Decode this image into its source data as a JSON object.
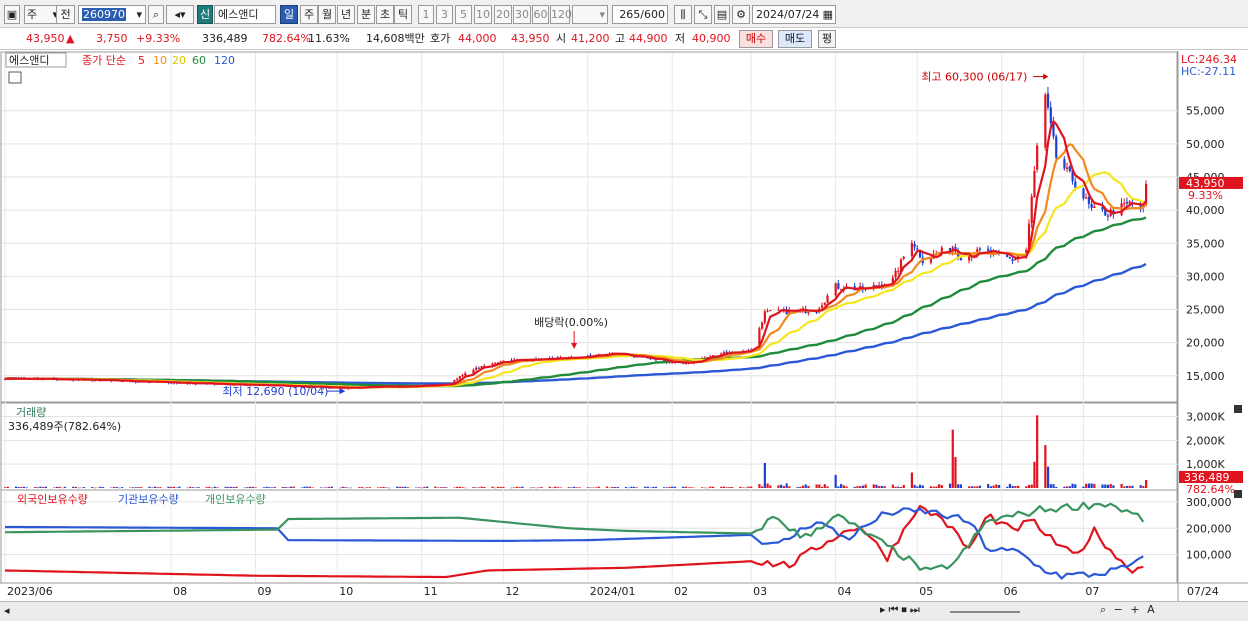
{
  "toolbar": {
    "period_week": "주",
    "prev_label": "전",
    "code": "260970",
    "new_badge": "신",
    "stock_name": "에스앤디",
    "periods": [
      "일",
      "주",
      "월",
      "년",
      "분",
      "초",
      "틱"
    ],
    "numbers": [
      "1",
      "3",
      "5",
      "10",
      "20",
      "30",
      "60",
      "120"
    ],
    "count": "265",
    "count_total": "/600",
    "date": "2024/07/24"
  },
  "quote": {
    "price": "43,950",
    "change_arrow": "▲",
    "change": "3,750",
    "change_pct": "+9.33%",
    "volume": "336,489",
    "volume_pct": "782.64%",
    "turnover_pct": "11.63%",
    "amount": "14,608백만",
    "ask_label": "호가",
    "ask1": "44,000",
    "ask2": "43,950",
    "open_label": "시",
    "open": "41,200",
    "high_label": "고",
    "high": "44,900",
    "low_label": "저",
    "low": "40,900",
    "buy_label": "매수",
    "sell_label": "매도",
    "avg_label": "평"
  },
  "colors": {
    "up": "#e0141e",
    "down": "#1b3fd1",
    "ma5": "#e0141e",
    "ma10": "#f08a1c",
    "ma20": "#f5e61c",
    "ma60": "#1e8c3a",
    "ma120": "#2b58d6",
    "foreign": "#e0141e",
    "institution": "#2b58d6",
    "individual": "#3b9460"
  },
  "chart_data": [
    {
      "type": "candlestick",
      "legend": {
        "name": "에스앤디",
        "close_label": "종가 단순",
        "ma_periods": [
          "5",
          "10",
          "20",
          "60",
          "120"
        ]
      },
      "lc_label": "LC:246.34",
      "hc_label": "HC:-27.11",
      "price_ticks": [
        "55,000",
        "50,000",
        "45,000",
        "40,000",
        "35,000",
        "30,000",
        "25,000",
        "20,000",
        "15,000"
      ],
      "price_tick_values": [
        55000,
        50000,
        45000,
        40000,
        35000,
        30000,
        25000,
        20000,
        15000
      ],
      "ylim": [
        11500,
        62500
      ],
      "current_price_label": "43,950",
      "current_pct_label": "9.33%",
      "current_price": 43950,
      "annotations": {
        "high": {
          "text": "최고 60,300 (06/17)",
          "value": 60300,
          "date": "2024/06/17"
        },
        "low": {
          "text": "최저 12,690 (10/04)",
          "value": 12690,
          "date": "2023/10/04"
        },
        "dividend": {
          "text": "배당락(0.00%)",
          "date": "2023/12/27"
        }
      },
      "close_anchors": [
        [
          "2023/06/01",
          14600
        ],
        [
          "2023/07/01",
          14400
        ],
        [
          "2023/08/01",
          14000
        ],
        [
          "2023/09/01",
          13600
        ],
        [
          "2023/10/04",
          13200
        ],
        [
          "2023/11/01",
          13500
        ],
        [
          "2023/11/10",
          13700
        ],
        [
          "2023/11/20",
          16000
        ],
        [
          "2023/12/01",
          17300
        ],
        [
          "2023/12/27",
          17700
        ],
        [
          "2024/01/10",
          18400
        ],
        [
          "2024/02/05",
          16800
        ],
        [
          "2024/02/20",
          18500
        ],
        [
          "2024/03/01",
          18800
        ],
        [
          "2024/03/06",
          24500
        ],
        [
          "2024/03/25",
          25000
        ],
        [
          "2024/04/01",
          28500
        ],
        [
          "2024/04/12",
          28000
        ],
        [
          "2024/04/22",
          29500
        ],
        [
          "2024/04/29",
          35500
        ],
        [
          "2024/05/03",
          32500
        ],
        [
          "2024/05/14",
          34500
        ],
        [
          "2024/05/17",
          33000
        ],
        [
          "2024/05/25",
          33800
        ],
        [
          "2024/06/05",
          32500
        ],
        [
          "2024/06/10",
          34000
        ],
        [
          "2024/06/14",
          49500
        ],
        [
          "2024/06/17",
          57000
        ],
        [
          "2024/06/21",
          48000
        ],
        [
          "2024/06/28",
          44000
        ],
        [
          "2024/07/04",
          40000
        ],
        [
          "2024/07/10",
          39500
        ],
        [
          "2024/07/18",
          41000
        ],
        [
          "2024/07/22",
          40200
        ],
        [
          "2024/07/23",
          40200
        ],
        [
          "2024/07/24",
          43950
        ]
      ],
      "ma_end_values": {
        "ma5": 41200,
        "ma10": 41000,
        "ma20": 40300,
        "ma60": 38000,
        "ma120": 31000
      },
      "volume_panel": {
        "title": "거래량",
        "current_text": "336,489주(782.64%)",
        "ticks": [
          "3,000K",
          "2,000K",
          "1,000K"
        ],
        "tick_values": [
          3000000,
          2000000,
          1000000
        ],
        "ylim": [
          0,
          3400000
        ],
        "current_label": "336,489",
        "current_pct_label": "782.64%",
        "current_value": 336489,
        "spikes": [
          [
            "2024/03/06",
            1050000,
            "down"
          ],
          [
            "2024/04/01",
            550000,
            "down"
          ],
          [
            "2024/04/29",
            650000,
            "up"
          ],
          [
            "2024/05/14",
            2450000,
            "up"
          ],
          [
            "2024/05/15",
            1300000,
            "up"
          ],
          [
            "2024/06/13",
            1100000,
            "up"
          ],
          [
            "2024/06/14",
            3050000,
            "up"
          ],
          [
            "2024/06/17",
            1800000,
            "up"
          ],
          [
            "2024/06/18",
            900000,
            "down"
          ]
        ]
      },
      "holding_panel": {
        "legend": [
          "외국인보유수량",
          "기관보유수량",
          "개인보유수량"
        ],
        "ticks": [
          "300,000",
          "200,000",
          "100,000"
        ],
        "tick_values": [
          300000,
          200000,
          100000
        ],
        "ylim": [
          0,
          330000
        ],
        "foreign": [
          [
            "2023/06/01",
            40000
          ],
          [
            "2023/09/01",
            20000
          ],
          [
            "2023/11/10",
            15000
          ],
          [
            "2023/11/25",
            40000
          ],
          [
            "2024/01/15",
            50000
          ],
          [
            "2024/03/01",
            75000
          ],
          [
            "2024/03/15",
            60000
          ],
          [
            "2024/04/01",
            170000
          ],
          [
            "2024/04/10",
            210000
          ],
          [
            "2024/04/20",
            90000
          ],
          [
            "2024/05/01",
            280000
          ],
          [
            "2024/05/10",
            240000
          ],
          [
            "2024/05/20",
            120000
          ],
          [
            "2024/05/27",
            250000
          ],
          [
            "2024/06/05",
            190000
          ],
          [
            "2024/06/12",
            230000
          ],
          [
            "2024/06/19",
            160000
          ],
          [
            "2024/06/28",
            90000
          ],
          [
            "2024/07/05",
            190000
          ],
          [
            "2024/07/15",
            70000
          ],
          [
            "2024/07/19",
            45000
          ],
          [
            "2024/07/24",
            55000
          ]
        ],
        "institution": [
          [
            "2023/06/01",
            205000
          ],
          [
            "2023/09/10",
            200000
          ],
          [
            "2023/09/12",
            155000
          ],
          [
            "2023/12/01",
            152000
          ],
          [
            "2024/01/01",
            155000
          ],
          [
            "2024/03/01",
            175000
          ],
          [
            "2024/03/10",
            130000
          ],
          [
            "2024/03/25",
            230000
          ],
          [
            "2024/04/05",
            160000
          ],
          [
            "2024/04/20",
            260000
          ],
          [
            "2024/05/05",
            265000
          ],
          [
            "2024/05/20",
            225000
          ],
          [
            "2024/05/27",
            120000
          ],
          [
            "2024/06/07",
            110000
          ],
          [
            "2024/06/15",
            50000
          ],
          [
            "2024/06/23",
            20000
          ],
          [
            "2024/07/05",
            25000
          ],
          [
            "2024/07/15",
            45000
          ],
          [
            "2024/07/24",
            85000
          ]
        ],
        "individual": [
          [
            "2023/06/01",
            185000
          ],
          [
            "2023/09/10",
            195000
          ],
          [
            "2023/09/12",
            235000
          ],
          [
            "2023/11/15",
            240000
          ],
          [
            "2023/12/25",
            200000
          ],
          [
            "2024/01/15",
            190000
          ],
          [
            "2024/03/01",
            180000
          ],
          [
            "2024/03/10",
            245000
          ],
          [
            "2024/03/20",
            160000
          ],
          [
            "2024/04/01",
            250000
          ],
          [
            "2024/04/25",
            100000
          ],
          [
            "2024/05/05",
            30000
          ],
          [
            "2024/05/15",
            70000
          ],
          [
            "2024/05/27",
            230000
          ],
          [
            "2024/06/07",
            250000
          ],
          [
            "2024/06/15",
            270000
          ],
          [
            "2024/06/25",
            280000
          ],
          [
            "2024/07/10",
            295000
          ],
          [
            "2024/07/24",
            230000
          ]
        ]
      },
      "x_labels": [
        "2023/06",
        "08",
        "09",
        "10",
        "11",
        "12",
        "2024/01",
        "02",
        "03",
        "04",
        "05",
        "06",
        "07"
      ],
      "x_label_dates": [
        "2023/06/01",
        "2023/08/01",
        "2023/09/01",
        "2023/10/01",
        "2023/11/01",
        "2023/12/01",
        "2024/01/01",
        "2024/02/01",
        "2024/03/01",
        "2024/04/01",
        "2024/05/01",
        "2024/06/01",
        "2024/07/01"
      ],
      "x_range": [
        "2023/06/01",
        "2024/07/24"
      ],
      "x_end_label": "07/24"
    }
  ]
}
